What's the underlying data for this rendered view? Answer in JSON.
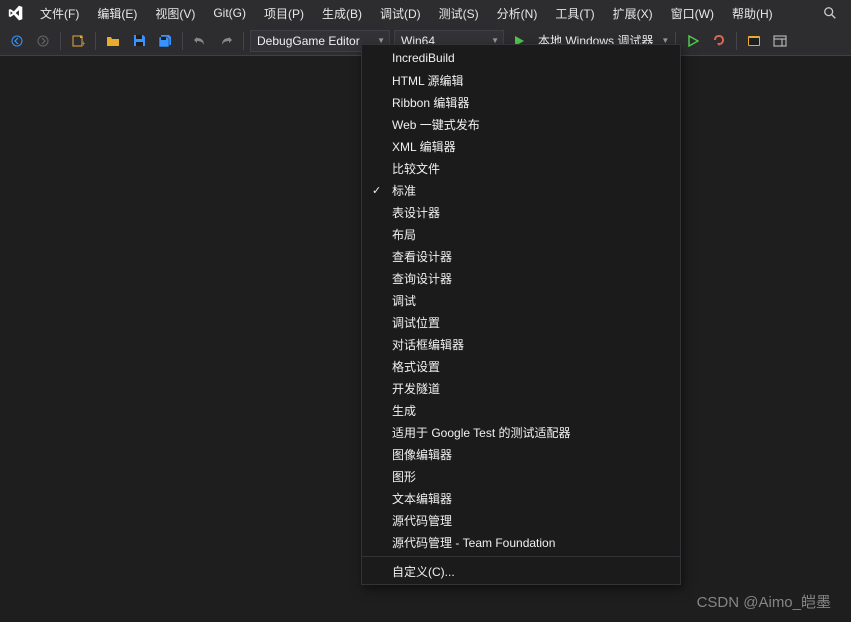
{
  "menubar": {
    "items": [
      {
        "label": "文件(F)",
        "key": "F"
      },
      {
        "label": "编辑(E)",
        "key": "E"
      },
      {
        "label": "视图(V)",
        "key": "V"
      },
      {
        "label": "Git(G)",
        "key": "G"
      },
      {
        "label": "项目(P)",
        "key": "P"
      },
      {
        "label": "生成(B)",
        "key": "B"
      },
      {
        "label": "调试(D)",
        "key": "D"
      },
      {
        "label": "测试(S)",
        "key": "S"
      },
      {
        "label": "分析(N)",
        "key": "N"
      },
      {
        "label": "工具(T)",
        "key": "T"
      },
      {
        "label": "扩展(X)",
        "key": "X"
      },
      {
        "label": "窗口(W)",
        "key": "W"
      },
      {
        "label": "帮助(H)",
        "key": "H"
      }
    ]
  },
  "toolbar": {
    "config_dropdown": "DebugGame Editor",
    "platform_dropdown": "Win64",
    "debugger_label": "本地 Windows 调试器"
  },
  "context_menu": {
    "items": [
      {
        "label": "IncrediBuild",
        "checked": false
      },
      {
        "label": "HTML 源编辑",
        "checked": false
      },
      {
        "label": "Ribbon 编辑器",
        "checked": false
      },
      {
        "label": "Web 一键式发布",
        "checked": false
      },
      {
        "label": "XML 编辑器",
        "checked": false
      },
      {
        "label": "比较文件",
        "checked": false
      },
      {
        "label": "标准",
        "checked": true
      },
      {
        "label": "表设计器",
        "checked": false
      },
      {
        "label": "布局",
        "checked": false
      },
      {
        "label": "查看设计器",
        "checked": false
      },
      {
        "label": "查询设计器",
        "checked": false
      },
      {
        "label": "调试",
        "checked": false
      },
      {
        "label": "调试位置",
        "checked": false
      },
      {
        "label": "对话框编辑器",
        "checked": false
      },
      {
        "label": "格式设置",
        "checked": false
      },
      {
        "label": "开发隧道",
        "checked": false
      },
      {
        "label": "生成",
        "checked": false
      },
      {
        "label": "适用于 Google Test 的测试适配器",
        "checked": false
      },
      {
        "label": "图像编辑器",
        "checked": false
      },
      {
        "label": "图形",
        "checked": false
      },
      {
        "label": "文本编辑器",
        "checked": false
      },
      {
        "label": "源代码管理",
        "checked": false
      },
      {
        "label": "源代码管理 - Team Foundation",
        "checked": false
      }
    ],
    "customize_label": "自定义(C)..."
  },
  "watermark": "CSDN @Aimo_皑墨"
}
